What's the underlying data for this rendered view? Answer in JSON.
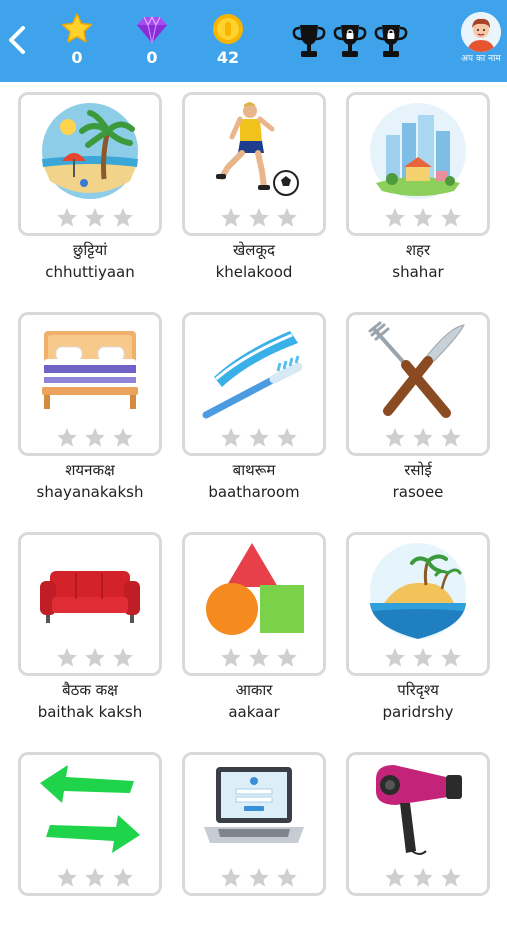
{
  "header": {
    "back_icon": "chevron-left-icon",
    "stats": [
      {
        "icon": "star-icon",
        "value": "0"
      },
      {
        "icon": "diamond-icon",
        "value": "0"
      },
      {
        "icon": "coin-icon",
        "value": "42"
      }
    ],
    "trophies": [
      "trophy-icon",
      "locked-trophy-icon",
      "locked-trophy-icon"
    ],
    "profile_label": "अप का नाम",
    "bar_color": "#3ea3ea"
  },
  "categories": [
    {
      "hindi": "छुट्टियां",
      "translit": "chhuttiyaan",
      "icon": "beach-icon",
      "stars": 0
    },
    {
      "hindi": "खेलकूद",
      "translit": "khelakood",
      "icon": "soccer-player-icon",
      "stars": 0
    },
    {
      "hindi": "शहर",
      "translit": "shahar",
      "icon": "city-icon",
      "stars": 0
    },
    {
      "hindi": "शयनकक्ष",
      "translit": "shayanakaksh",
      "icon": "bed-icon",
      "stars": 0
    },
    {
      "hindi": "बाथरूम",
      "translit": "baatharoom",
      "icon": "toothbrush-icon",
      "stars": 0
    },
    {
      "hindi": "रसोई",
      "translit": "rasoee",
      "icon": "fork-knife-icon",
      "stars": 0
    },
    {
      "hindi": "बैठक कक्ष",
      "translit": "baithak kaksh",
      "icon": "sofa-icon",
      "stars": 0
    },
    {
      "hindi": "आकार",
      "translit": "aakaar",
      "icon": "shapes-icon",
      "stars": 0
    },
    {
      "hindi": "परिदृश्य",
      "translit": "paridrshy",
      "icon": "island-icon",
      "stars": 0
    },
    {
      "hindi": "",
      "translit": "",
      "icon": "arrows-icon",
      "stars": 0
    },
    {
      "hindi": "",
      "translit": "",
      "icon": "laptop-icon",
      "stars": 0
    },
    {
      "hindi": "",
      "translit": "",
      "icon": "hair-dryer-icon",
      "stars": 0
    }
  ]
}
